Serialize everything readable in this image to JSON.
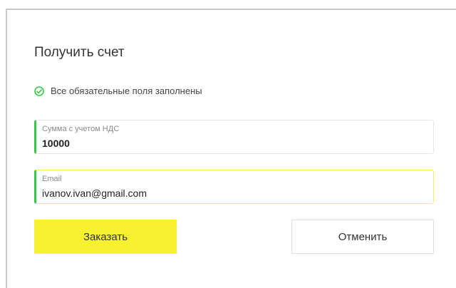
{
  "dialog": {
    "title": "Получить счет",
    "status_text": "Все обязательные поля заполнены",
    "status_icon": "check-circle-icon",
    "accent_color": "#36c948",
    "button_color": "#f6f22f"
  },
  "fields": {
    "amount": {
      "label": "Сумма с учетом НДС",
      "value": "10000"
    },
    "email": {
      "label": "Email",
      "value": "ivanov.ivan@gmail.com"
    }
  },
  "actions": {
    "order_label": "Заказать",
    "cancel_label": "Отменить"
  }
}
